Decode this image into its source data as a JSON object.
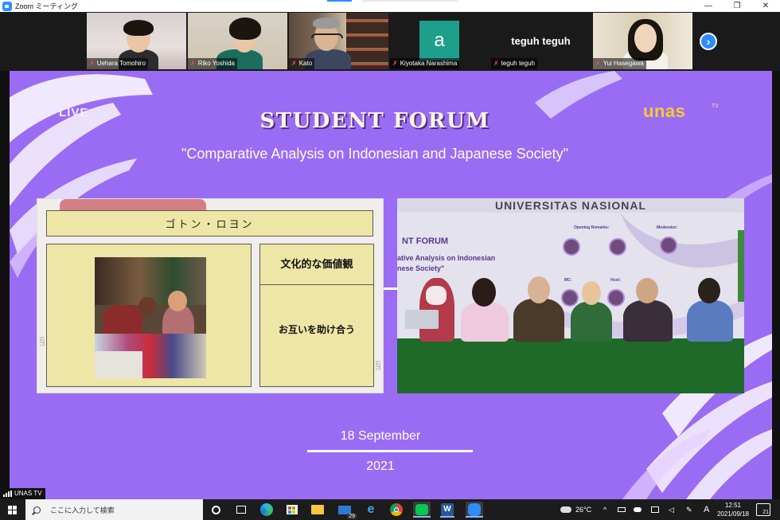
{
  "window": {
    "title": "Zoom ミーティング",
    "minimize_glyph": "—",
    "restore_glyph": "❐",
    "close_glyph": "✕"
  },
  "gallery": {
    "participants": [
      {
        "name": "Uehara Tomohiro",
        "video": true
      },
      {
        "name": "Riko Yoshida",
        "video": true
      },
      {
        "name": "Kato",
        "video": true
      },
      {
        "name": "Kiyotaka Narashima",
        "video": false,
        "avatar_letter": "a",
        "avatar_color": "#1e9f8c"
      },
      {
        "name": "teguh teguh",
        "video": false,
        "display_text": "teguh teguh"
      },
      {
        "name": "Yui Hasegawa",
        "video": true
      }
    ],
    "next_page_icon": "chevron-right-icon",
    "next_glyph": "›",
    "muted_glyph": "✗"
  },
  "slide": {
    "live_label": "LIVE",
    "logo_text": "unas",
    "logo_sub": "TV",
    "title": "STUDENT FORUM",
    "subtitle": "\"Comparative Analysis on Indonesian and Japanese Society\"",
    "card": {
      "heading": "ゴトン・ロヨン",
      "value_label": "文化的な価値観",
      "value_text": "お互いを助け合う"
    },
    "video": {
      "banner_top": "UNIVERSITAS NASIONAL",
      "banner_title1": "NT FORUM",
      "banner_title2_line1": "ative Analysis on Indonesian",
      "banner_title2_line2": "nese Society\"",
      "roles": [
        "Opening Remarks:",
        "Moderator:",
        "MC:",
        "Host:"
      ]
    },
    "date_day": "18 September",
    "date_year": "2021"
  },
  "stage_label": "UNAS TV",
  "colors": {
    "slide_bg": "#9a6cf4",
    "zoom_blue": "#2d8cff",
    "card_yellow": "#ede6a6",
    "logo_gold": "#f6cc2c"
  },
  "taskbar": {
    "search_placeholder": "ここに入力して検索",
    "mail_badge": "29",
    "temperature": "26°C",
    "ime": "A",
    "time": "12:51",
    "date": "2021/09/18",
    "notification_count": "21"
  }
}
